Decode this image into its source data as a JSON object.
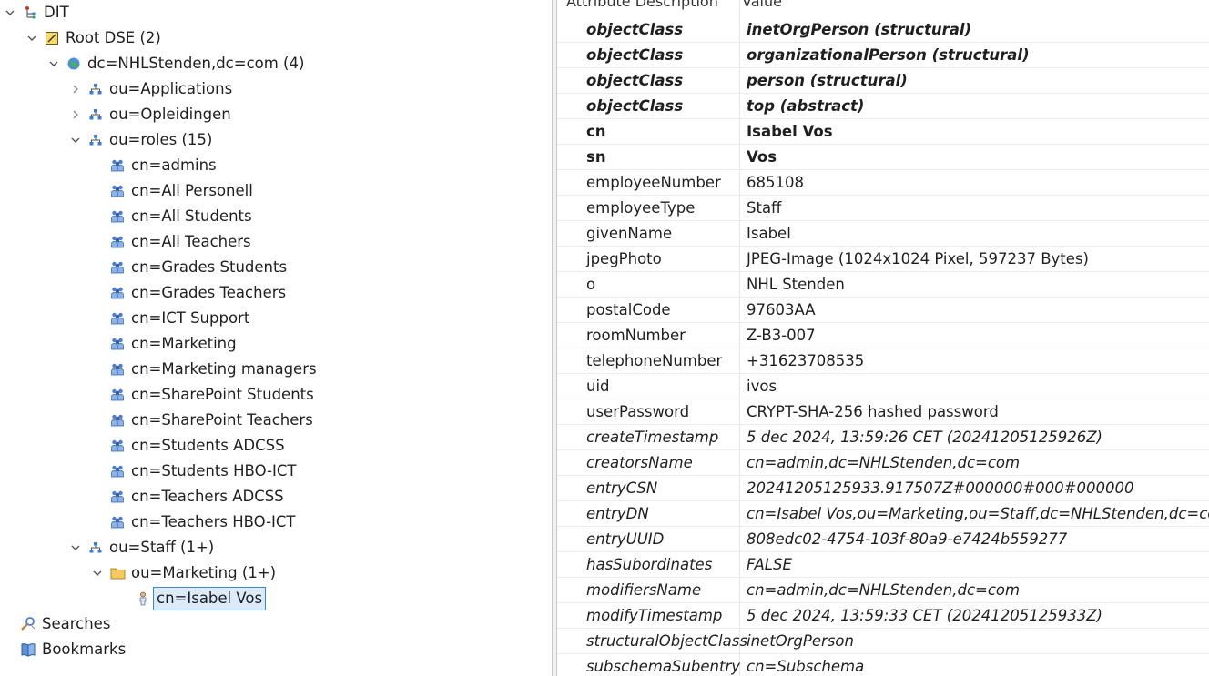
{
  "tree": {
    "dit": "DIT",
    "root_dse": "Root DSE (2)",
    "base": "dc=NHLStenden,dc=com (4)",
    "ou_applications": "ou=Applications",
    "ou_opleidingen": "ou=Opleidingen",
    "ou_roles": "ou=roles (15)",
    "roles": [
      "cn=admins",
      "cn=All Personell",
      "cn=All Students",
      "cn=All Teachers",
      "cn=Grades Students",
      "cn=Grades Teachers",
      "cn=ICT Support",
      "cn=Marketing",
      "cn=Marketing managers",
      "cn=SharePoint Students",
      "cn=SharePoint Teachers",
      "cn=Students ADCSS",
      "cn=Students HBO-ICT",
      "cn=Teachers ADCSS",
      "cn=Teachers HBO-ICT"
    ],
    "ou_staff": "ou=Staff (1+)",
    "ou_marketing": "ou=Marketing (1+)",
    "selected_entry": "cn=Isabel Vos",
    "searches": "Searches",
    "bookmarks": "Bookmarks"
  },
  "table": {
    "header_attr": "Attribute Description",
    "header_value": "Value",
    "rows": [
      {
        "attr": "objectClass",
        "value": "inetOrgPerson (structural)"
      },
      {
        "attr": "objectClass",
        "value": "organizationalPerson (structural)"
      },
      {
        "attr": "objectClass",
        "value": "person (structural)"
      },
      {
        "attr": "objectClass",
        "value": "top (abstract)"
      },
      {
        "attr": "cn",
        "value": "Isabel Vos"
      },
      {
        "attr": "sn",
        "value": "Vos"
      },
      {
        "attr": "employeeNumber",
        "value": "685108"
      },
      {
        "attr": "employeeType",
        "value": "Staff"
      },
      {
        "attr": "givenName",
        "value": "Isabel"
      },
      {
        "attr": "jpegPhoto",
        "value": "JPEG-Image (1024x1024 Pixel, 597237 Bytes)"
      },
      {
        "attr": "o",
        "value": "NHL Stenden"
      },
      {
        "attr": "postalCode",
        "value": "97603AA"
      },
      {
        "attr": "roomNumber",
        "value": "Z-B3-007"
      },
      {
        "attr": "telephoneNumber",
        "value": "+31623708535"
      },
      {
        "attr": "uid",
        "value": "ivos"
      },
      {
        "attr": "userPassword",
        "value": "CRYPT-SHA-256 hashed password"
      },
      {
        "attr": "createTimestamp",
        "value": "5 dec 2024, 13:59:26 CET (20241205125926Z)"
      },
      {
        "attr": "creatorsName",
        "value": "cn=admin,dc=NHLStenden,dc=com"
      },
      {
        "attr": "entryCSN",
        "value": "20241205125933.917507Z#000000#000#000000"
      },
      {
        "attr": "entryDN",
        "value": "cn=Isabel Vos,ou=Marketing,ou=Staff,dc=NHLStenden,dc=com"
      },
      {
        "attr": "entryUUID",
        "value": "808edc02-4754-103f-80a9-e7424b559277"
      },
      {
        "attr": "hasSubordinates",
        "value": "FALSE"
      },
      {
        "attr": "modifiersName",
        "value": "cn=admin,dc=NHLStenden,dc=com"
      },
      {
        "attr": "modifyTimestamp",
        "value": "5 dec 2024, 13:59:33 CET (20241205125933Z)"
      },
      {
        "attr": "structuralObjectClass",
        "value": "inetOrgPerson"
      },
      {
        "attr": "subschemaSubentry",
        "value": "cn=Subschema"
      }
    ]
  }
}
